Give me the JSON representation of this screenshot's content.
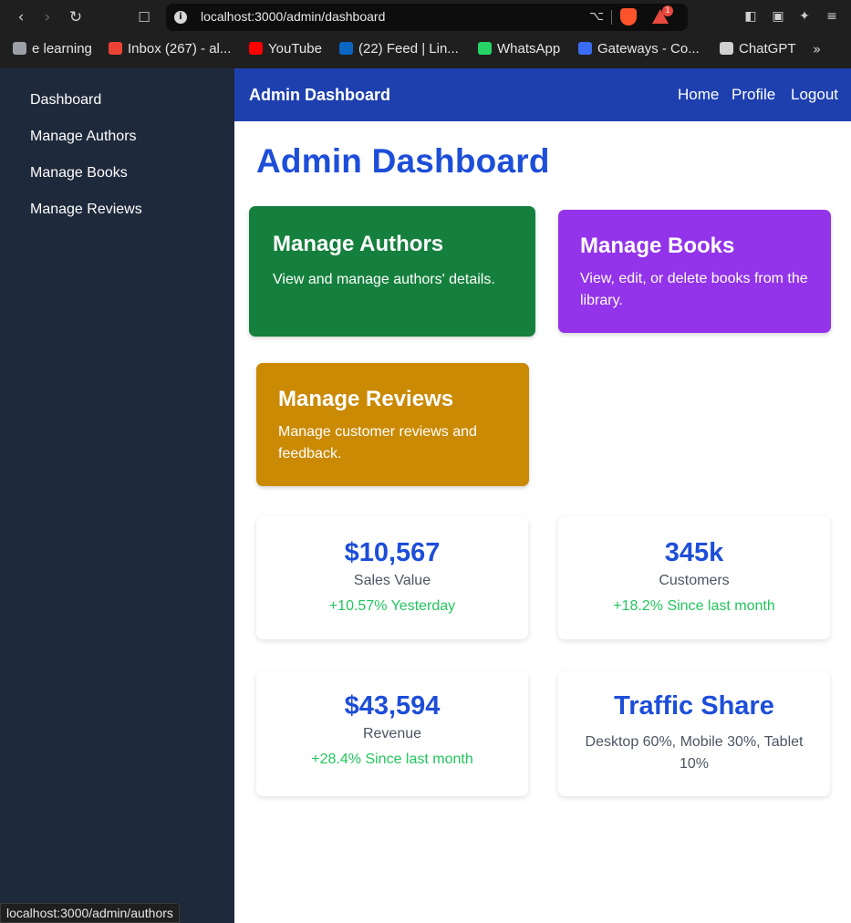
{
  "browser": {
    "url": "localhost:3000/admin/dashboard",
    "rewards_badge": "1",
    "bookmarks": [
      {
        "label": "e learning",
        "icon": "document-icon",
        "color": "#9aa0a6"
      },
      {
        "label": "Inbox (267) - al...",
        "icon": "gmail-icon",
        "color": "#ea4335"
      },
      {
        "label": "YouTube",
        "icon": "youtube-icon",
        "color": "#ff0000"
      },
      {
        "label": "(22) Feed | Lin...",
        "icon": "linkedin-icon",
        "color": "#0a66c2"
      },
      {
        "label": "WhatsApp",
        "icon": "whatsapp-icon",
        "color": "#25d366"
      },
      {
        "label": "Gateways - Co...",
        "icon": "gateways-icon",
        "color": "#3b6cf6"
      },
      {
        "label": "ChatGPT",
        "icon": "chatgpt-icon",
        "color": "#d0d0d0"
      }
    ],
    "status_url": "localhost:3000/admin/authors"
  },
  "sidebar": {
    "items": [
      {
        "label": "Dashboard"
      },
      {
        "label": "Manage Authors"
      },
      {
        "label": "Manage Books"
      },
      {
        "label": "Manage Reviews"
      }
    ]
  },
  "header": {
    "brand": "Admin Dashboard",
    "links": [
      {
        "label": "Home"
      },
      {
        "label": "Profile"
      },
      {
        "label": "Logout"
      }
    ]
  },
  "main": {
    "title": "Admin Dashboard",
    "cards": [
      {
        "title": "Manage Authors",
        "desc": "View and manage authors' details.",
        "color": "#15803d"
      },
      {
        "title": "Manage Books",
        "desc": "View, edit, or delete books from the library.",
        "color": "#9333ea"
      },
      {
        "title": "Manage Reviews",
        "desc": "Manage customer reviews and feedback.",
        "color": "#ca8a04"
      }
    ],
    "stats": [
      {
        "value": "$10,567",
        "label": "Sales Value",
        "change": "+10.57% Yesterday"
      },
      {
        "value": "345k",
        "label": "Customers",
        "change": "+18.2% Since last month"
      },
      {
        "value": "$43,594",
        "label": "Revenue",
        "change": "+28.4% Since last month"
      },
      {
        "value": "Traffic Share",
        "label": "Desktop 60%, Mobile 30%, Tablet 10%"
      }
    ]
  },
  "colors": {
    "accent": "#1d4ed8",
    "header_bg": "#1e40af",
    "sidebar_bg": "#1e293b",
    "positive": "#22c55e"
  }
}
